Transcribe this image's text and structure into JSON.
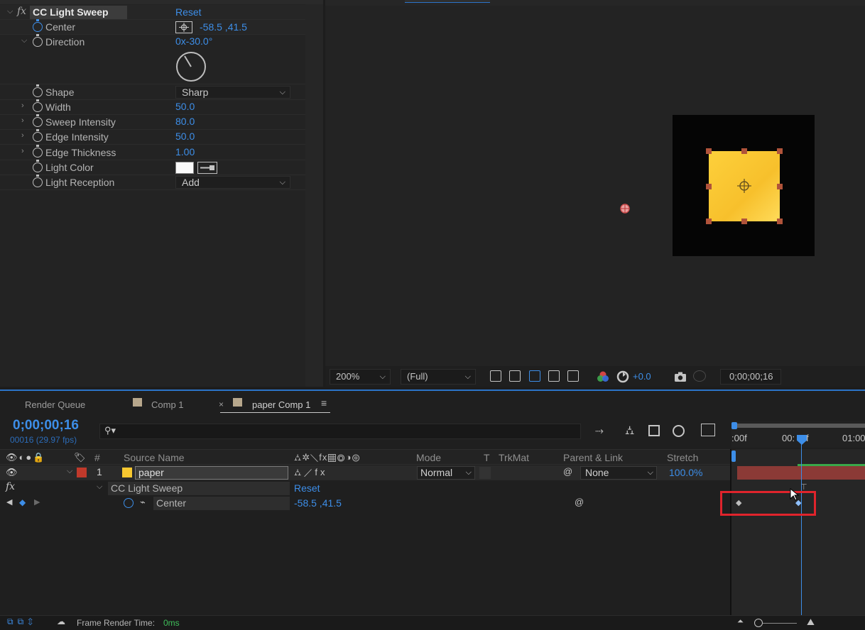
{
  "effect_controls": {
    "effect_name": "CC Light Sweep",
    "reset_label": "Reset",
    "fx_label": "fx",
    "properties": [
      {
        "label": "Center",
        "value": "-58.5 ,41.5"
      },
      {
        "label": "Direction",
        "value": "0x-30.0°"
      },
      {
        "label": "Shape",
        "value": "Sharp"
      },
      {
        "label": "Width",
        "value": "50.0"
      },
      {
        "label": "Sweep Intensity",
        "value": "80.0"
      },
      {
        "label": "Edge Intensity",
        "value": "50.0"
      },
      {
        "label": "Edge Thickness",
        "value": "1.00"
      },
      {
        "label": "Light Color",
        "value": ""
      },
      {
        "label": "Light Reception",
        "value": "Add"
      }
    ]
  },
  "viewer": {
    "zoom": "200%",
    "resolution": "(Full)",
    "exposure": "+0.0",
    "timecode": "0;00;00;16",
    "square_color": "#fcc93a",
    "handle_color": "#b0533a"
  },
  "timeline": {
    "tabs": [
      "Render Queue",
      "Comp 1",
      "paper Comp 1"
    ],
    "current_time": "0;00;00;16",
    "frame_info": "00016 (29.97 fps)",
    "columns": {
      "source_name": "Source Name",
      "mode": "Mode",
      "t": "T",
      "trkmat": "TrkMat",
      "parent_link": "Parent & Link",
      "stretch": "Stretch"
    },
    "layer": {
      "number": "1",
      "name": "paper",
      "mode": "Normal",
      "parent": "None",
      "stretch": "100.0%"
    },
    "effect_row": {
      "name": "CC Light Sweep",
      "reset": "Reset"
    },
    "property_row": {
      "name": "Center",
      "value": "-58.5 ,41.5"
    },
    "ruler": {
      "start": ":00f",
      "mid": "00:",
      "mid_suffix": "f",
      "end": "01:00"
    },
    "footer": {
      "label": "Frame Render Time:",
      "value": "0ms"
    },
    "layer_color": "#c0392b",
    "track_color": "#8b3a36"
  }
}
